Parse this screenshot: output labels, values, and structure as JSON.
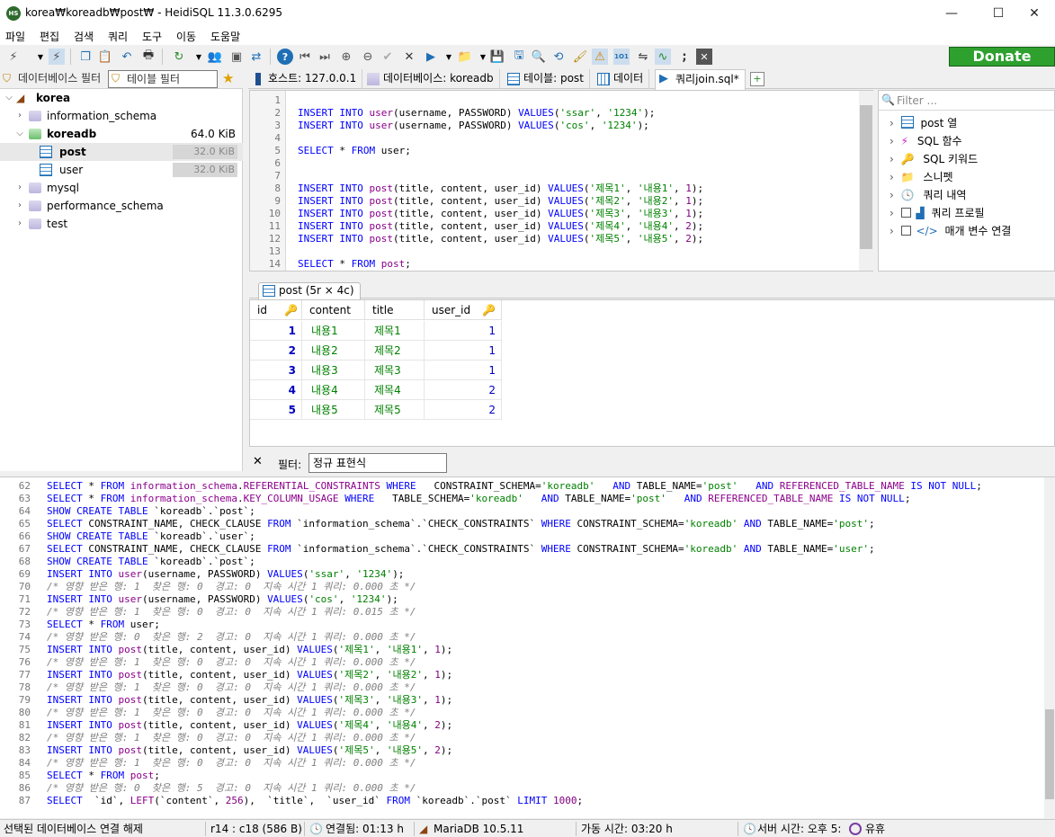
{
  "window": {
    "title": "korea₩koreadb₩post₩ - HeidiSQL 11.3.0.6295",
    "app_icon": "HS"
  },
  "menu": [
    "파일",
    "편집",
    "검색",
    "쿼리",
    "도구",
    "이동",
    "도움말"
  ],
  "donate_label": "Donate",
  "left_filters": {
    "db_filter": "데이터베이스 필터",
    "table_filter": "테이블 필터"
  },
  "tree": {
    "root": "korea",
    "items": [
      {
        "label": "information_schema",
        "size": ""
      },
      {
        "label": "koreadb",
        "size": "64.0 KiB"
      },
      {
        "label": "post",
        "size": "32.0 KiB"
      },
      {
        "label": "user",
        "size": "32.0 KiB"
      },
      {
        "label": "mysql",
        "size": ""
      },
      {
        "label": "performance_schema",
        "size": ""
      },
      {
        "label": "test",
        "size": ""
      }
    ]
  },
  "tabs": [
    "호스트: 127.0.0.1",
    "데이터베이스: koreadb",
    "테이블: post",
    "데이터",
    "쿼리join.sql*"
  ],
  "editor": {
    "line_numbers": [
      "1",
      "2",
      "3",
      "4",
      "5",
      "6",
      "7",
      "8",
      "9",
      "10",
      "11",
      "12",
      "13",
      "14"
    ]
  },
  "helper": {
    "filter_placeholder": "Filter ...",
    "items": [
      "post 열",
      "SQL 함수",
      "SQL 키워드",
      "스니펫",
      "쿼리 내역",
      "쿼리 프로필",
      "매개 변수 연결"
    ]
  },
  "result": {
    "tab_label": "post (5r × 4c)",
    "columns": [
      "id",
      "content",
      "title",
      "user_id"
    ],
    "rows": [
      [
        "1",
        "내용1",
        "제목1",
        "1"
      ],
      [
        "2",
        "내용2",
        "제목2",
        "1"
      ],
      [
        "3",
        "내용3",
        "제목3",
        "1"
      ],
      [
        "4",
        "내용4",
        "제목4",
        "2"
      ],
      [
        "5",
        "내용5",
        "제목5",
        "2"
      ]
    ]
  },
  "filter_row": {
    "label": "필터:",
    "placeholder": "정규 표현식"
  },
  "status": {
    "disconnect": "선택된 데이터베이스 연결 해제",
    "position": "r14 : c18 (586 B)",
    "connected": "연결됨: 01:13 h",
    "server": "MariaDB 10.5.11",
    "uptime": "가동 시간: 03:20 h",
    "server_time": "서버 시간: 오후 5:",
    "idle": "유휴"
  },
  "colors": {
    "keyword": "#0000ff",
    "string": "#008000",
    "table": "#8b008b",
    "donate": "#2ea02e"
  }
}
